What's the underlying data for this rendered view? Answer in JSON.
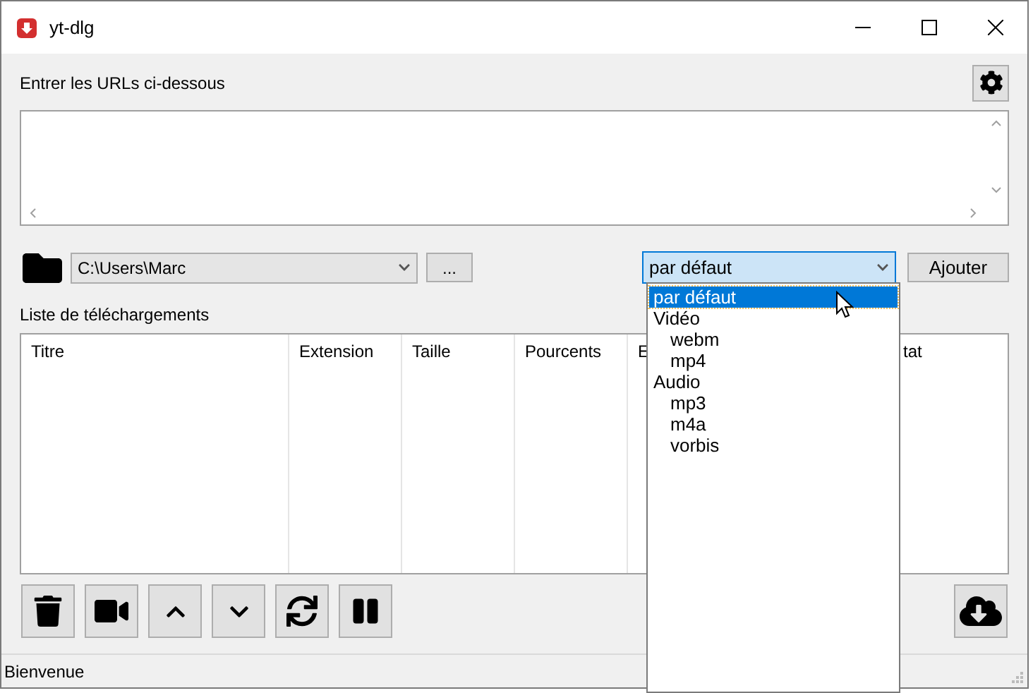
{
  "window": {
    "title": "yt-dlg"
  },
  "url_section": {
    "label": "Entrer les URLs ci-dessous"
  },
  "path": {
    "value": "C:\\Users\\Marc"
  },
  "browse_button": "...",
  "format": {
    "value": "par défaut",
    "expanded": true,
    "options": [
      {
        "label": "par défaut",
        "selected": true
      },
      {
        "label": "Vidéo",
        "selected": false,
        "children": [
          {
            "label": "webm",
            "selected": false
          },
          {
            "label": "mp4",
            "selected": false
          }
        ]
      },
      {
        "label": "Audio",
        "selected": false,
        "children": [
          {
            "label": "mp3",
            "selected": false
          },
          {
            "label": "m4a",
            "selected": false
          },
          {
            "label": "vorbis",
            "selected": false
          }
        ]
      }
    ]
  },
  "add_button": "Ajouter",
  "list_label": "Liste de téléchargements",
  "table": {
    "columns": [
      "Titre",
      "Extension",
      "Taille",
      "Pourcents",
      "E",
      "tat"
    ]
  },
  "status_bar": "Bienvenue"
}
